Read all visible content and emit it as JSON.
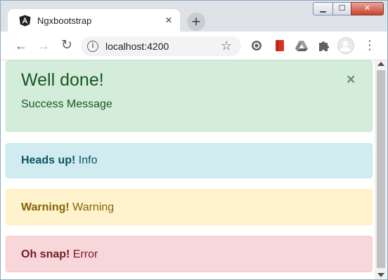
{
  "browser": {
    "tab": {
      "title": "Ngxbootstrap",
      "favicon": "angular-icon",
      "close": "×"
    },
    "new_tab": "+",
    "window_controls": {
      "minimize": "▁",
      "maximize": "☐",
      "close": "✕"
    },
    "toolbar": {
      "back": "←",
      "forward": "→",
      "reload": "↻",
      "url": "localhost:4200",
      "info": "i",
      "star": "☆",
      "extensions": [
        "record-icon",
        "red-book-icon",
        "drive-icon",
        "puzzle-icon"
      ],
      "menu": "⋮"
    }
  },
  "alerts": {
    "success": {
      "heading": "Well done!",
      "message": "Success Message",
      "close": "×",
      "color": "#d4edda"
    },
    "info": {
      "strong": "Heads up!",
      "text": " Info",
      "color": "#d1ecf1"
    },
    "warning": {
      "strong": "Warning!",
      "text": " Warning",
      "color": "#fff3cd"
    },
    "danger": {
      "strong": "Oh snap!",
      "text": " Error",
      "color": "#f8d7da"
    }
  }
}
